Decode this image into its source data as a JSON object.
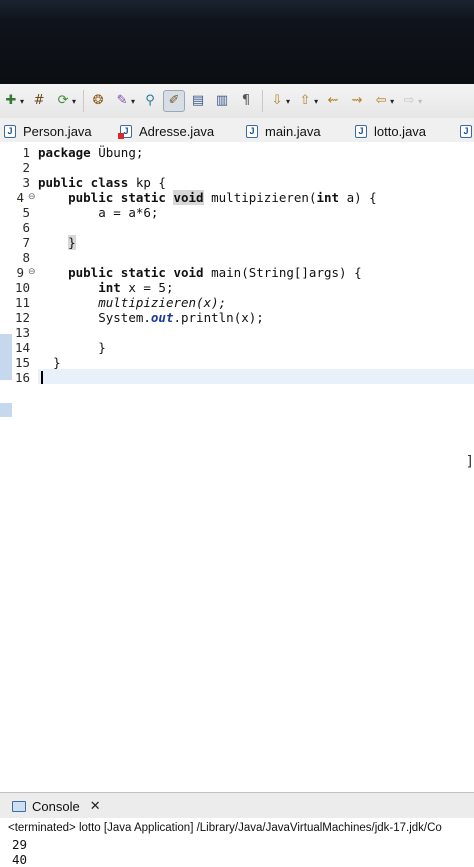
{
  "tabs": [
    {
      "label": "Person.java",
      "icon": "java-file-icon"
    },
    {
      "label": "Adresse.java",
      "icon": "java-file-error-icon"
    },
    {
      "label": "main.java",
      "icon": "java-file-icon"
    },
    {
      "label": "lotto.java",
      "icon": "java-file-icon"
    }
  ],
  "editor": {
    "line_numbers": [
      "1",
      "2",
      "3",
      "4",
      "5",
      "6",
      "7",
      "8",
      "9",
      "10",
      "11",
      "12",
      "13",
      "14",
      "15",
      "16"
    ],
    "fold_markers": [
      "⊖",
      "⊖"
    ],
    "lines": {
      "l1_kw": "package",
      "l1_rest": " Übung;",
      "l3_kw": "public class",
      "l3_rest": " kp {",
      "l4_kw1": "public static",
      "l4_kw2": "void",
      "l4_mid": " multipizieren(",
      "l4_kw3": "int",
      "l4_end": " a) {",
      "l5": "a = a*6;",
      "l7": "}",
      "l9_kw1": "public static void",
      "l9_rest": " main(String[]args) {",
      "l10_kw": "int",
      "l10_rest": " x = 5;",
      "l11": "multipizieren(x);",
      "l12_a": "System.",
      "l12_b": "out",
      "l12_c": ".println(x);",
      "l14": "}",
      "l15": "}"
    }
  },
  "console": {
    "tab_label": "Console",
    "close_symbol": "✕",
    "terminated": "<terminated> lotto [Java Application] /Library/Java/JavaVirtualMachines/jdk-17.jdk/Co",
    "output": [
      "29",
      "40"
    ]
  }
}
